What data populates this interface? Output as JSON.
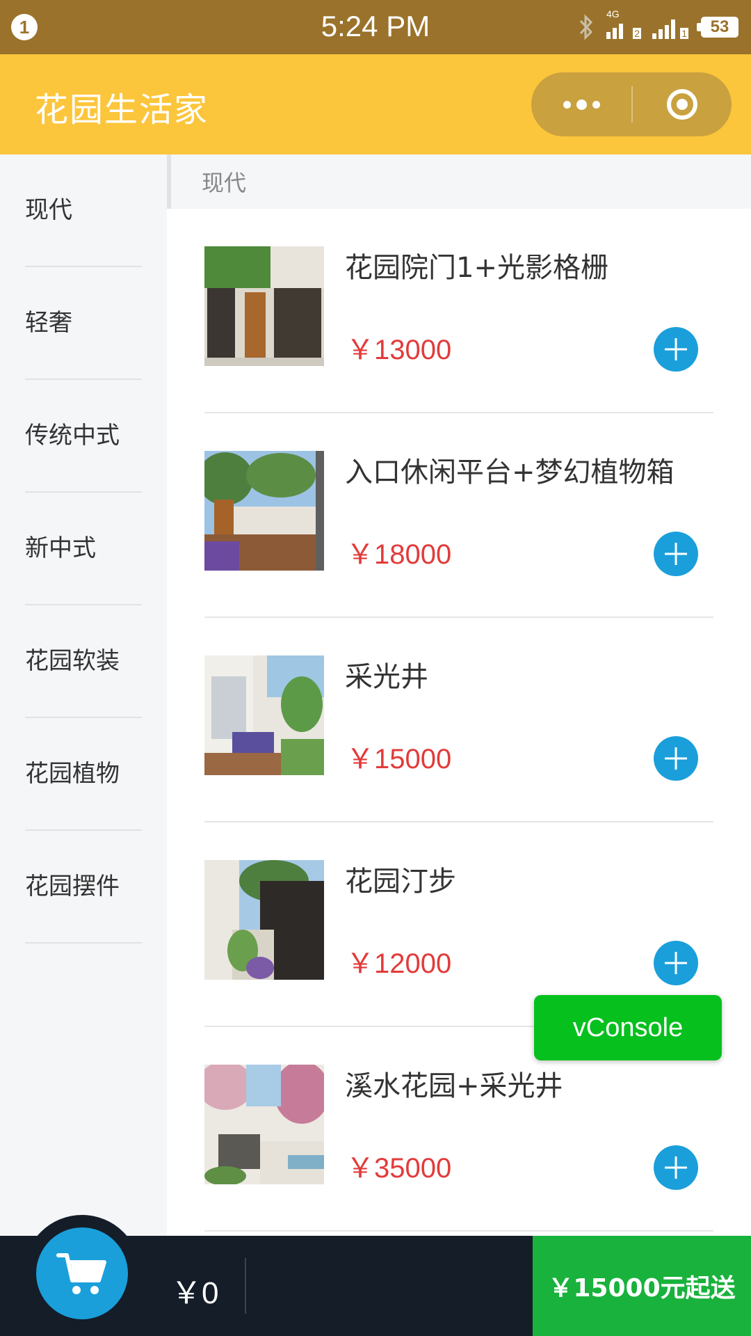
{
  "status_bar": {
    "notification_count": "1",
    "time": "5:24 PM",
    "network": "4G",
    "sim1": "2",
    "sim2": "1",
    "battery": "53"
  },
  "nav": {
    "title": "花园生活家",
    "more_icon": "more-dots-icon",
    "close_icon": "target-close-icon"
  },
  "sidebar": {
    "items": [
      {
        "label": "现代",
        "active": true
      },
      {
        "label": "轻奢"
      },
      {
        "label": "传统中式"
      },
      {
        "label": "新中式"
      },
      {
        "label": "花园软装"
      },
      {
        "label": "花园植物"
      },
      {
        "label": "花园摆件"
      }
    ]
  },
  "section": {
    "title": "现代"
  },
  "products": [
    {
      "name": "花园院门1+光影格栅",
      "price": "￥13000"
    },
    {
      "name": "入口休闲平台+梦幻植物箱",
      "price": "￥18000"
    },
    {
      "name": "采光井",
      "price": "￥15000"
    },
    {
      "name": "花园汀步",
      "price": "￥12000"
    },
    {
      "name": "溪水花园+采光井",
      "price": "￥35000"
    }
  ],
  "vconsole": {
    "label": "vConsole"
  },
  "cart": {
    "icon": "shopping-cart-icon",
    "total": "￥0",
    "min_order": "￥15000元起送"
  },
  "colors": {
    "status_bar": "#9a722b",
    "nav_bar": "#fcc63c",
    "price": "#e23b3b",
    "add_button": "#1a9fdb",
    "vconsole": "#06c01e",
    "cart_bar": "#141d28",
    "min_order_button": "#18b23c"
  }
}
